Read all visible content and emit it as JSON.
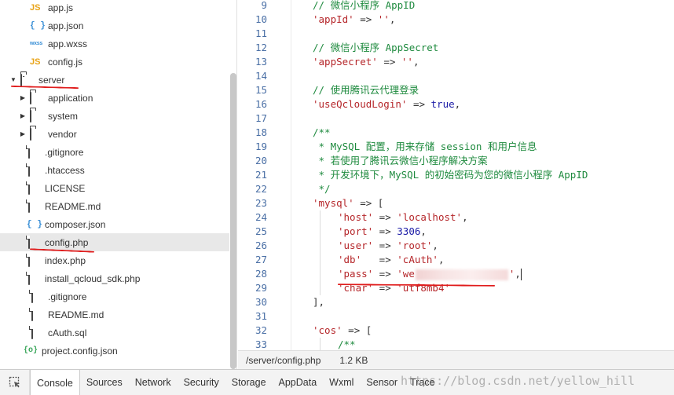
{
  "tree": {
    "items": [
      {
        "label": "app.js",
        "icon": "js-file-icon",
        "kind": "js",
        "indent": 1
      },
      {
        "label": "app.json",
        "icon": "json-file-icon",
        "kind": "json",
        "indent": 1
      },
      {
        "label": "app.wxss",
        "icon": "wxss-file-icon",
        "kind": "wxss",
        "indent": 1
      },
      {
        "label": "config.js",
        "icon": "js-file-icon",
        "kind": "js",
        "indent": 1
      },
      {
        "label": "server",
        "icon": "folder-open-icon",
        "kind": "folder-open",
        "indent": 0
      },
      {
        "label": "application",
        "icon": "folder-icon",
        "kind": "folder",
        "indent": 1
      },
      {
        "label": "system",
        "icon": "folder-icon",
        "kind": "folder",
        "indent": 1
      },
      {
        "label": "vendor",
        "icon": "folder-icon",
        "kind": "folder",
        "indent": 1
      },
      {
        "label": ".gitignore",
        "icon": "file-icon",
        "kind": "file",
        "indent": 2
      },
      {
        "label": ".htaccess",
        "icon": "file-icon",
        "kind": "file",
        "indent": 2
      },
      {
        "label": "LICENSE",
        "icon": "file-icon",
        "kind": "file",
        "indent": 2
      },
      {
        "label": "README.md",
        "icon": "file-icon",
        "kind": "file",
        "indent": 2
      },
      {
        "label": "composer.json",
        "icon": "json-file-icon",
        "kind": "json",
        "indent": 2
      },
      {
        "label": "config.php",
        "icon": "file-icon",
        "kind": "file",
        "indent": 2,
        "selected": true
      },
      {
        "label": "index.php",
        "icon": "file-icon",
        "kind": "file",
        "indent": 2
      },
      {
        "label": "install_qcloud_sdk.php",
        "icon": "file-icon",
        "kind": "file",
        "indent": 2
      },
      {
        "label": ".gitignore",
        "icon": "file-icon",
        "kind": "file",
        "indent": 1
      },
      {
        "label": "README.md",
        "icon": "file-icon",
        "kind": "file",
        "indent": 1
      },
      {
        "label": "cAuth.sql",
        "icon": "file-icon",
        "kind": "file",
        "indent": 1
      },
      {
        "label": "project.config.json",
        "icon": "config-file-icon",
        "kind": "cfg",
        "indent": 0
      }
    ]
  },
  "editor": {
    "lines": [
      {
        "n": "9",
        "indent": 1,
        "tokens": [
          {
            "t": "// 微信小程序 AppID",
            "c": "t-comment"
          }
        ]
      },
      {
        "n": "10",
        "indent": 1,
        "tokens": [
          {
            "t": "'appId'",
            "c": "t-string"
          },
          {
            "t": " => ",
            "c": "t-op"
          },
          {
            "t": "''",
            "c": "t-string"
          },
          {
            "t": ",",
            "c": "t-op"
          }
        ]
      },
      {
        "n": "11",
        "indent": 0,
        "tokens": []
      },
      {
        "n": "12",
        "indent": 1,
        "tokens": [
          {
            "t": "// 微信小程序 AppSecret",
            "c": "t-comment"
          }
        ]
      },
      {
        "n": "13",
        "indent": 1,
        "tokens": [
          {
            "t": "'appSecret'",
            "c": "t-string"
          },
          {
            "t": " => ",
            "c": "t-op"
          },
          {
            "t": "''",
            "c": "t-string"
          },
          {
            "t": ",",
            "c": "t-op"
          }
        ]
      },
      {
        "n": "14",
        "indent": 0,
        "tokens": []
      },
      {
        "n": "15",
        "indent": 1,
        "tokens": [
          {
            "t": "// 使用腾讯云代理登录",
            "c": "t-comment"
          }
        ]
      },
      {
        "n": "16",
        "indent": 1,
        "tokens": [
          {
            "t": "'useQcloudLogin'",
            "c": "t-string"
          },
          {
            "t": " => ",
            "c": "t-op"
          },
          {
            "t": "true",
            "c": "t-kw"
          },
          {
            "t": ",",
            "c": "t-op"
          }
        ]
      },
      {
        "n": "17",
        "indent": 0,
        "tokens": []
      },
      {
        "n": "18",
        "indent": 1,
        "tokens": [
          {
            "t": "/**",
            "c": "t-comment"
          }
        ]
      },
      {
        "n": "19",
        "indent": 1,
        "tokens": [
          {
            "t": " * MySQL 配置，用来存储 session 和用户信息",
            "c": "t-comment"
          }
        ]
      },
      {
        "n": "20",
        "indent": 1,
        "tokens": [
          {
            "t": " * 若使用了腾讯云微信小程序解决方案",
            "c": "t-comment"
          }
        ]
      },
      {
        "n": "21",
        "indent": 1,
        "tokens": [
          {
            "t": " * 开发环境下，MySQL 的初始密码为您的微信小程序 AppID",
            "c": "t-comment"
          }
        ]
      },
      {
        "n": "22",
        "indent": 1,
        "tokens": [
          {
            "t": " */",
            "c": "t-comment"
          }
        ]
      },
      {
        "n": "23",
        "indent": 1,
        "tokens": [
          {
            "t": "'mysql'",
            "c": "t-string"
          },
          {
            "t": " => [",
            "c": "t-op"
          }
        ]
      },
      {
        "n": "24",
        "indent": 2,
        "tokens": [
          {
            "t": "'host'",
            "c": "t-string"
          },
          {
            "t": " => ",
            "c": "t-op"
          },
          {
            "t": "'localhost'",
            "c": "t-string"
          },
          {
            "t": ",",
            "c": "t-op"
          }
        ]
      },
      {
        "n": "25",
        "indent": 2,
        "tokens": [
          {
            "t": "'port'",
            "c": "t-string"
          },
          {
            "t": " => ",
            "c": "t-op"
          },
          {
            "t": "3306",
            "c": "t-num"
          },
          {
            "t": ",",
            "c": "t-op"
          }
        ]
      },
      {
        "n": "26",
        "indent": 2,
        "tokens": [
          {
            "t": "'user'",
            "c": "t-string"
          },
          {
            "t": " => ",
            "c": "t-op"
          },
          {
            "t": "'root'",
            "c": "t-string"
          },
          {
            "t": ",",
            "c": "t-op"
          }
        ]
      },
      {
        "n": "27",
        "indent": 2,
        "tokens": [
          {
            "t": "'db'",
            "c": "t-string"
          },
          {
            "t": "   => ",
            "c": "t-op"
          },
          {
            "t": "'cAuth'",
            "c": "t-string"
          },
          {
            "t": ",",
            "c": "t-op"
          }
        ]
      },
      {
        "n": "28",
        "indent": 2,
        "tokens": [
          {
            "t": "'pass'",
            "c": "t-string"
          },
          {
            "t": " => ",
            "c": "t-op"
          },
          {
            "t": "'we",
            "c": "t-string"
          },
          {
            "t": "",
            "c": "blur"
          },
          {
            "t": "'",
            "c": "t-string"
          },
          {
            "t": ",",
            "c": "t-op"
          },
          {
            "t": "",
            "c": "cursor"
          }
        ]
      },
      {
        "n": "29",
        "indent": 2,
        "tokens": [
          {
            "t": "'char'",
            "c": "t-string"
          },
          {
            "t": " => ",
            "c": "t-op"
          },
          {
            "t": "'utf8mb4'",
            "c": "t-string"
          }
        ]
      },
      {
        "n": "30",
        "indent": 1,
        "tokens": [
          {
            "t": "],",
            "c": "t-op"
          }
        ]
      },
      {
        "n": "31",
        "indent": 0,
        "tokens": []
      },
      {
        "n": "32",
        "indent": 1,
        "tokens": [
          {
            "t": "'cos'",
            "c": "t-string"
          },
          {
            "t": " => [",
            "c": "t-op"
          }
        ]
      },
      {
        "n": "33",
        "indent": 2,
        "tokens": [
          {
            "t": "/**",
            "c": "t-comment"
          }
        ]
      }
    ]
  },
  "status": {
    "path": "/server/config.php",
    "size": "1.2 KB"
  },
  "tabs": {
    "inspect_icon": "inspect-icon",
    "items": [
      {
        "label": "Console",
        "active": true
      },
      {
        "label": "Sources"
      },
      {
        "label": "Network"
      },
      {
        "label": "Security"
      },
      {
        "label": "Storage"
      },
      {
        "label": "AppData"
      },
      {
        "label": "Wxml"
      },
      {
        "label": "Sensor"
      },
      {
        "label": "Trace"
      }
    ]
  },
  "watermark": "https://blog.csdn.net/yellow_hill",
  "colors": {
    "annotation": "#e01b1b",
    "comment": "#1e8a3e",
    "string": "#b5262a",
    "keyword": "#1a1aa6",
    "line_number": "#4a6fa5"
  }
}
